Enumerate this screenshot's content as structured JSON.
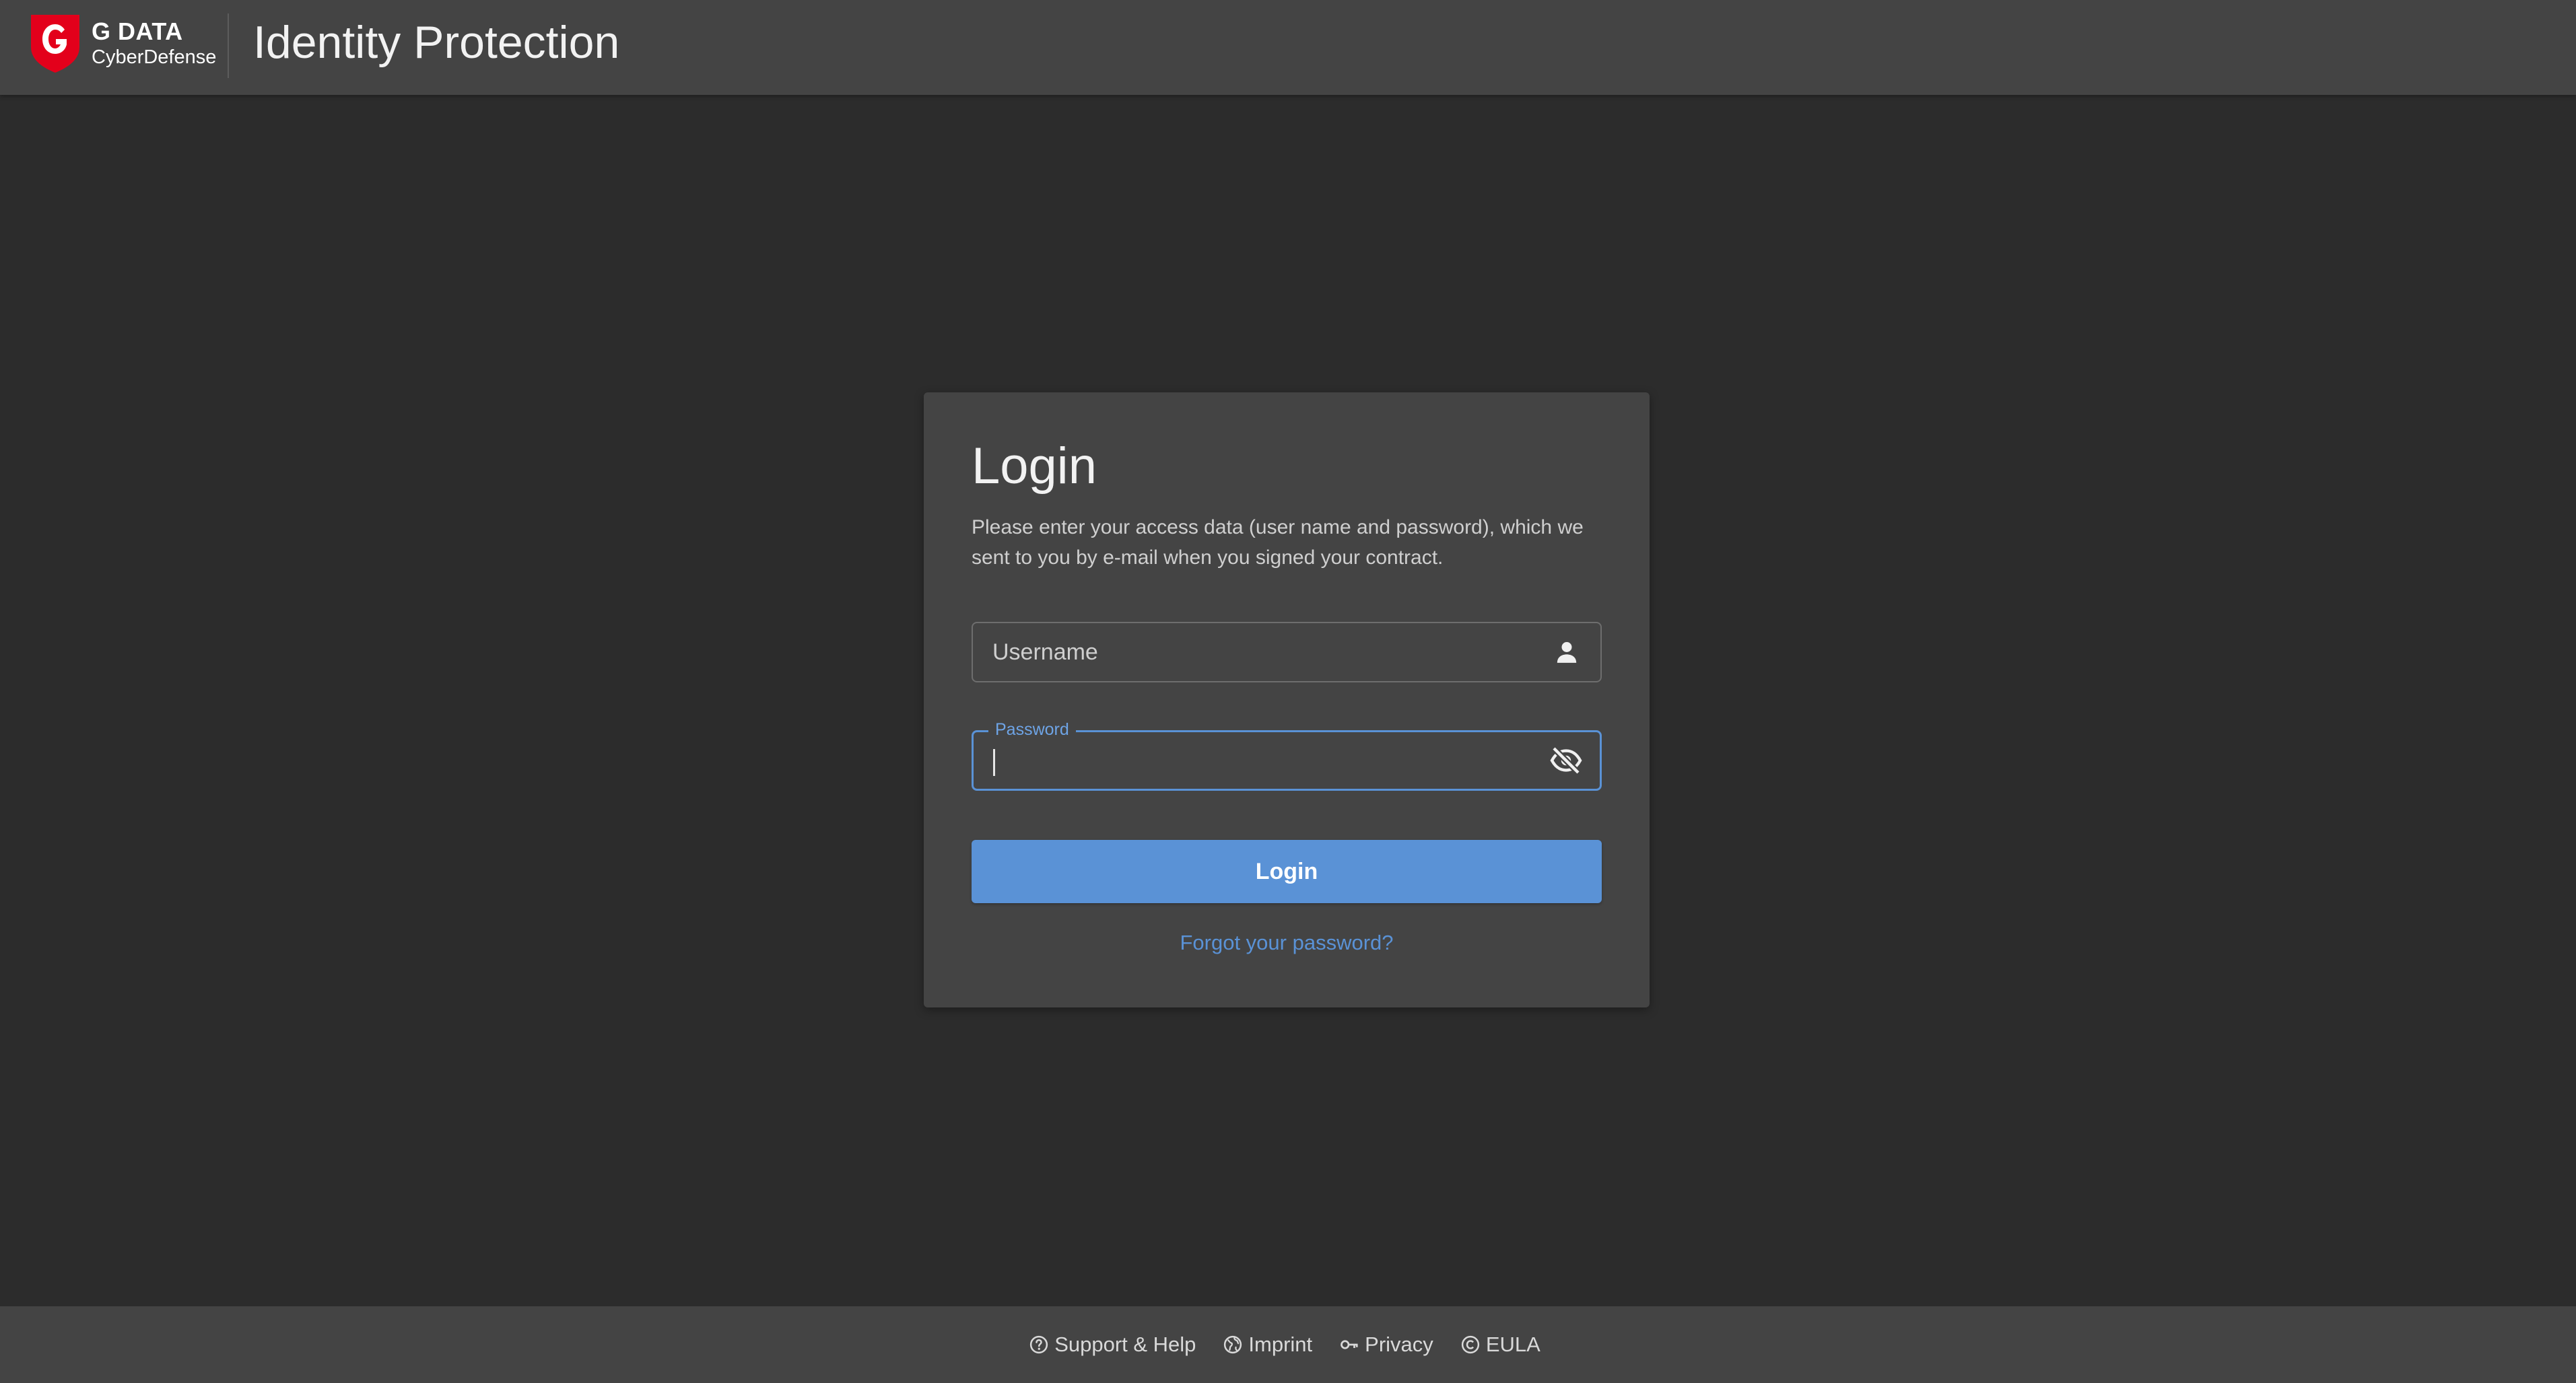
{
  "header": {
    "brand": "G DATA",
    "brand_sub": "CyberDefense",
    "title": "Identity Protection"
  },
  "login": {
    "title": "Login",
    "description": "Please enter your access data (user name and password), which we sent to you by e-mail when you signed your contract.",
    "username": {
      "placeholder": "Username",
      "value": "",
      "icon": "user-icon"
    },
    "password": {
      "label": "Password",
      "value": "",
      "icon": "eye-slash-icon"
    },
    "submit_label": "Login",
    "forgot_label": "Forgot your password?"
  },
  "footer": {
    "links": [
      {
        "label": "Support & Help",
        "icon": "question-circle-icon"
      },
      {
        "label": "Imprint",
        "icon": "globe-icon"
      },
      {
        "label": "Privacy",
        "icon": "key-icon"
      },
      {
        "label": "EULA",
        "icon": "copyright-icon"
      }
    ]
  },
  "colors": {
    "background": "#2c2c2c",
    "panel": "#444444",
    "accent": "#5a92d6",
    "brand_red": "#e3001b"
  }
}
